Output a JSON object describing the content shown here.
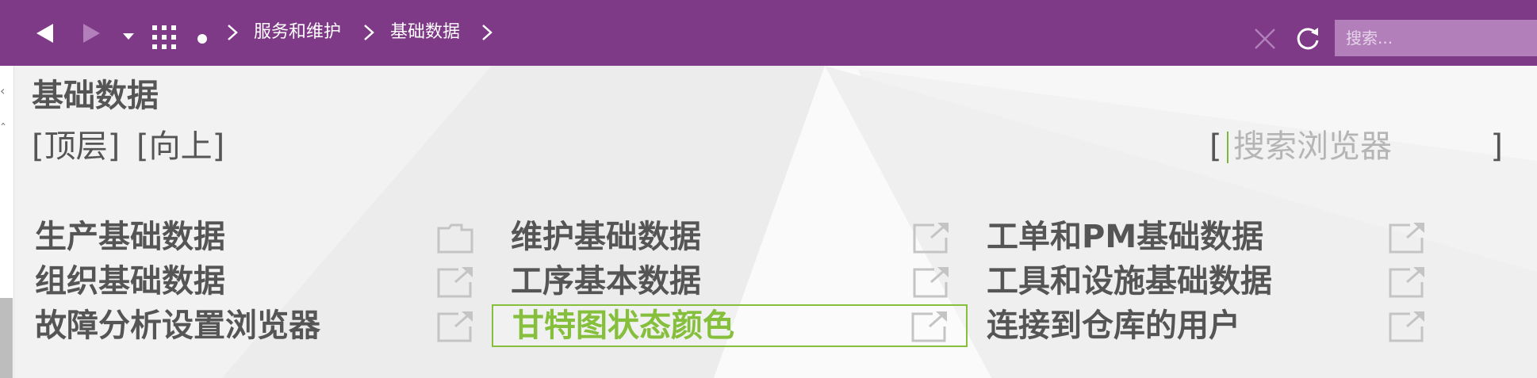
{
  "topbar": {
    "background": "#7e3a86",
    "search_placeholder": "搜索...",
    "breadcrumb": [
      {
        "label": "服务和维护"
      },
      {
        "label": "基础数据"
      }
    ],
    "icons": [
      "back-icon",
      "forward-icon",
      "dropdown-icon",
      "grid-menu-icon",
      "dot-icon",
      "close-icon",
      "refresh-icon"
    ]
  },
  "page": {
    "title": "基础数据",
    "nav_top": "[顶层]",
    "nav_up": "[向上]",
    "browser_search_placeholder": "搜索浏览器",
    "bracket_left": "[",
    "bracket_right": "]"
  },
  "grid": {
    "columns": [
      [
        {
          "label": "生产基础数据",
          "icon": "folder-icon"
        },
        {
          "label": "组织基础数据",
          "icon": "external-link-icon"
        },
        {
          "label": "故障分析设置浏览器",
          "icon": "external-link-icon"
        }
      ],
      [
        {
          "label": "维护基础数据",
          "icon": "external-link-icon"
        },
        {
          "label": "工序基本数据",
          "icon": "external-link-icon"
        },
        {
          "label": "甘特图状态颜色",
          "icon": "external-link-icon",
          "selected": true
        }
      ],
      [
        {
          "label": "工单和PM基础数据",
          "icon": "external-link-icon"
        },
        {
          "label": "工具和设施基础数据",
          "icon": "external-link-icon"
        },
        {
          "label": "连接到仓库的用户",
          "icon": "external-link-icon"
        }
      ]
    ]
  },
  "colors": {
    "accent_green": "#86bf3c",
    "text": "#555555",
    "background": "#f4f4f4"
  }
}
